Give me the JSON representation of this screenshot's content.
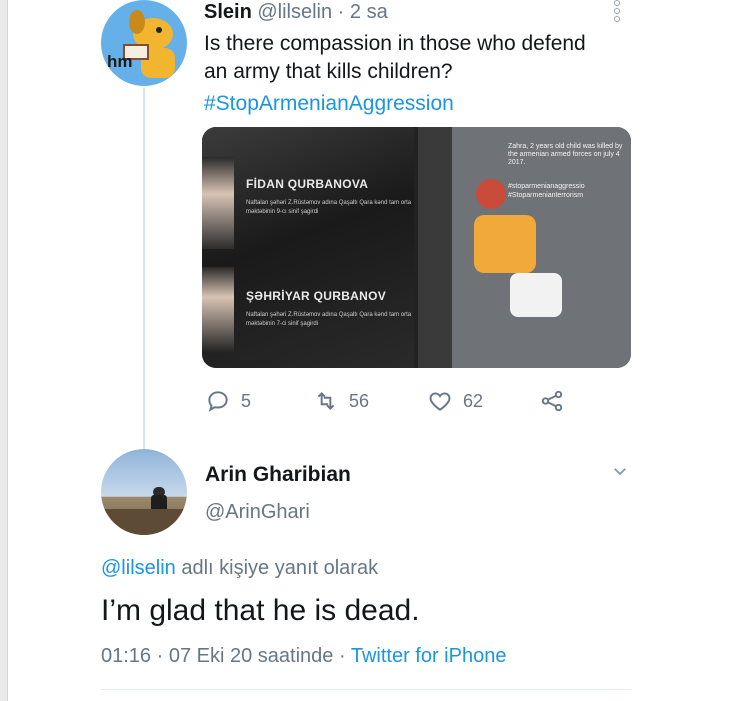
{
  "tweet": {
    "avatar_text": "hm",
    "name": "Slein",
    "handle": "@lilselin",
    "separator": " · ",
    "time": "2 sa",
    "text": "Is there compassion in those who defend an army that kills children?",
    "hashtag": "#StopArmenianAggression",
    "media": {
      "left": {
        "person1_name": "FİDAN QURBANOVA",
        "person1_desc": "Naftalan şəhəri Z.Rüstəmov adına Qaşaltı Qara kənd tam orta məktəbinin 9-cı sinif şagirdi",
        "person2_name": "ŞƏHRİYAR QURBANOV",
        "person2_desc": "Naftalan şəhəri Z.Rüstəmov adına Qaşaltı Qara kənd tam orta məktəbinin 7-ci sinif şagirdi"
      },
      "right": {
        "caption": "Zahra, 2 years old child was killed by the armenian armed forces on july 4 2017.",
        "tag1": "#stoparmenianaggressio",
        "tag2": "#Stoparmenianterrorism"
      }
    },
    "actions": {
      "replies": "5",
      "retweets": "56",
      "likes": "62"
    }
  },
  "reply": {
    "name": "Arin Gharibian",
    "handle": "@ArinGhari",
    "reply_to_mention": "@lilselin",
    "reply_to_suffix": " adlı kişiye yanıt olarak",
    "text": "I’m glad that he is dead.",
    "time": "01:16",
    "date": "07 Eki 20 saatinde",
    "dot": " · ",
    "via": "Twitter for iPhone"
  }
}
